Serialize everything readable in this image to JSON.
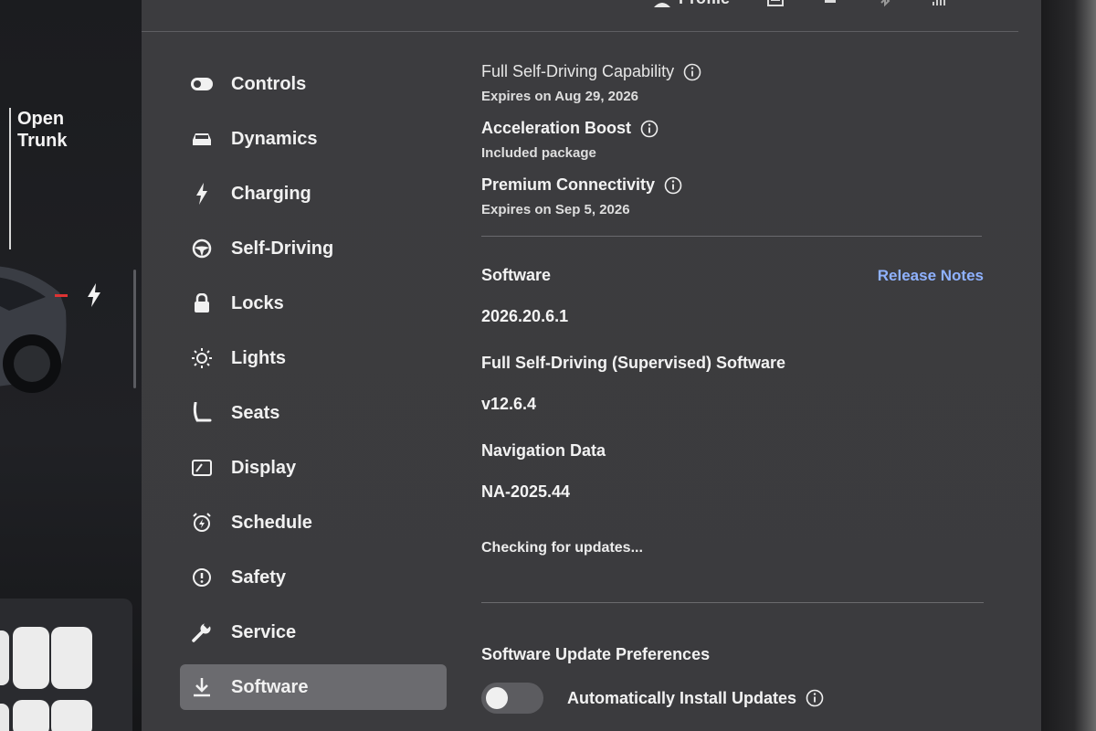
{
  "car_panel": {
    "trunk_label_line1": "Open",
    "trunk_label_line2": "Trunk"
  },
  "topbar": {
    "profile_label": "Profile"
  },
  "sidebar": {
    "items": [
      {
        "label": "Controls",
        "icon": "toggle-icon"
      },
      {
        "label": "Dynamics",
        "icon": "car-icon"
      },
      {
        "label": "Charging",
        "icon": "bolt-icon"
      },
      {
        "label": "Self-Driving",
        "icon": "steering-wheel-icon"
      },
      {
        "label": "Locks",
        "icon": "lock-icon"
      },
      {
        "label": "Lights",
        "icon": "sun-icon"
      },
      {
        "label": "Seats",
        "icon": "seat-icon"
      },
      {
        "label": "Display",
        "icon": "display-icon"
      },
      {
        "label": "Schedule",
        "icon": "alarm-clock-icon"
      },
      {
        "label": "Safety",
        "icon": "alert-circle-icon"
      },
      {
        "label": "Service",
        "icon": "wrench-icon"
      },
      {
        "label": "Software",
        "icon": "download-icon",
        "active": true
      }
    ]
  },
  "features": [
    {
      "title": "Full Self-Driving Capability",
      "subtitle": "Expires on Aug 29, 2026"
    },
    {
      "title": "Acceleration Boost",
      "subtitle": "Included package"
    },
    {
      "title": "Premium Connectivity",
      "subtitle": "Expires on Sep 5, 2026"
    }
  ],
  "software": {
    "label": "Software",
    "release_notes": "Release Notes",
    "version": "2026.20.6.1",
    "fsd_label": "Full Self-Driving (Supervised) Software",
    "fsd_version": "v12.6.4",
    "nav_label": "Navigation Data",
    "nav_version": "NA-2025.44",
    "status": "Checking for updates..."
  },
  "preferences": {
    "title": "Software Update Preferences",
    "auto_install_label": "Automatically Install Updates",
    "auto_install_on": false
  },
  "colors": {
    "accent_link": "#8fb2ff",
    "background": "#3c3c3f",
    "active_item": "#6b6b6f"
  }
}
